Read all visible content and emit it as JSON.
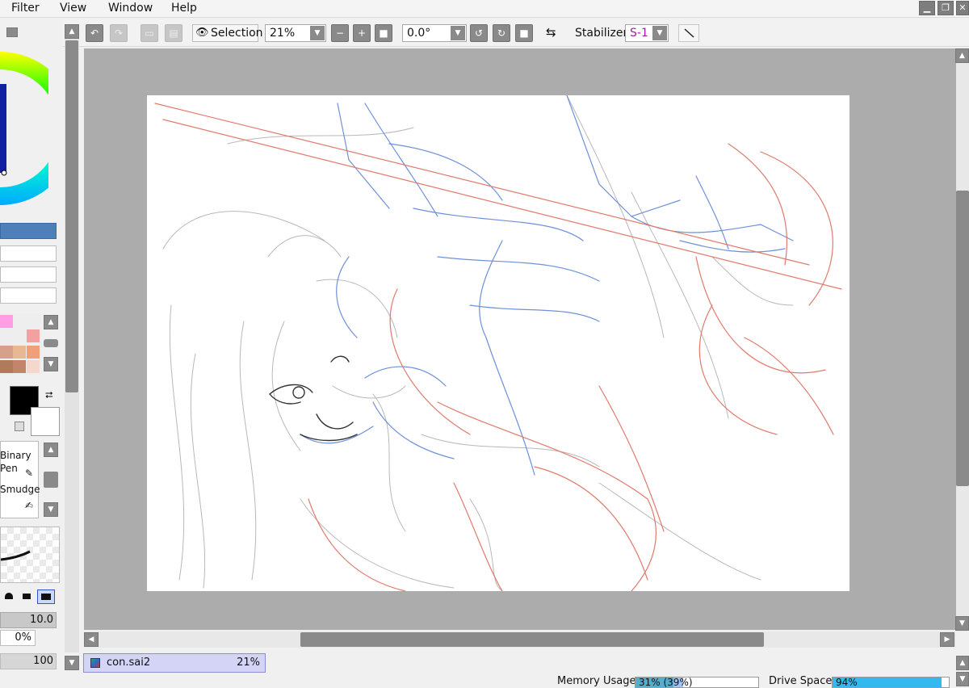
{
  "menu": {
    "items": [
      "Filter",
      "View",
      "Window",
      "Help"
    ]
  },
  "toolbar": {
    "selection_label": "Selection",
    "zoom_value": "21%",
    "rotation_value": "0.0°",
    "stabilizer_label": "Stabilizer",
    "stabilizer_value": "S-1"
  },
  "left_panel": {
    "brush_names": [
      "Binary",
      "Pen",
      "Smudge"
    ],
    "brush_size": "10.0",
    "min_size": "0%",
    "density": "100"
  },
  "file_tab": {
    "name": "con.sai2",
    "zoom": "21%"
  },
  "status": {
    "memory_label": "Memory Usage",
    "memory_value": "31% (39%)",
    "memory_fraction": 0.31,
    "drive_label": "Drive Space",
    "drive_value": "94%",
    "drive_fraction": 0.94
  },
  "colors": {
    "accent_blue": "#4f7fb8",
    "sketch_red": "#e07a6c",
    "sketch_blue": "#6f90d8",
    "canvas_gray": "#acacac",
    "stabilizer_text": "#a0209a",
    "memory_fill": "#33cc99",
    "drive_fill": "#33b9f0"
  }
}
